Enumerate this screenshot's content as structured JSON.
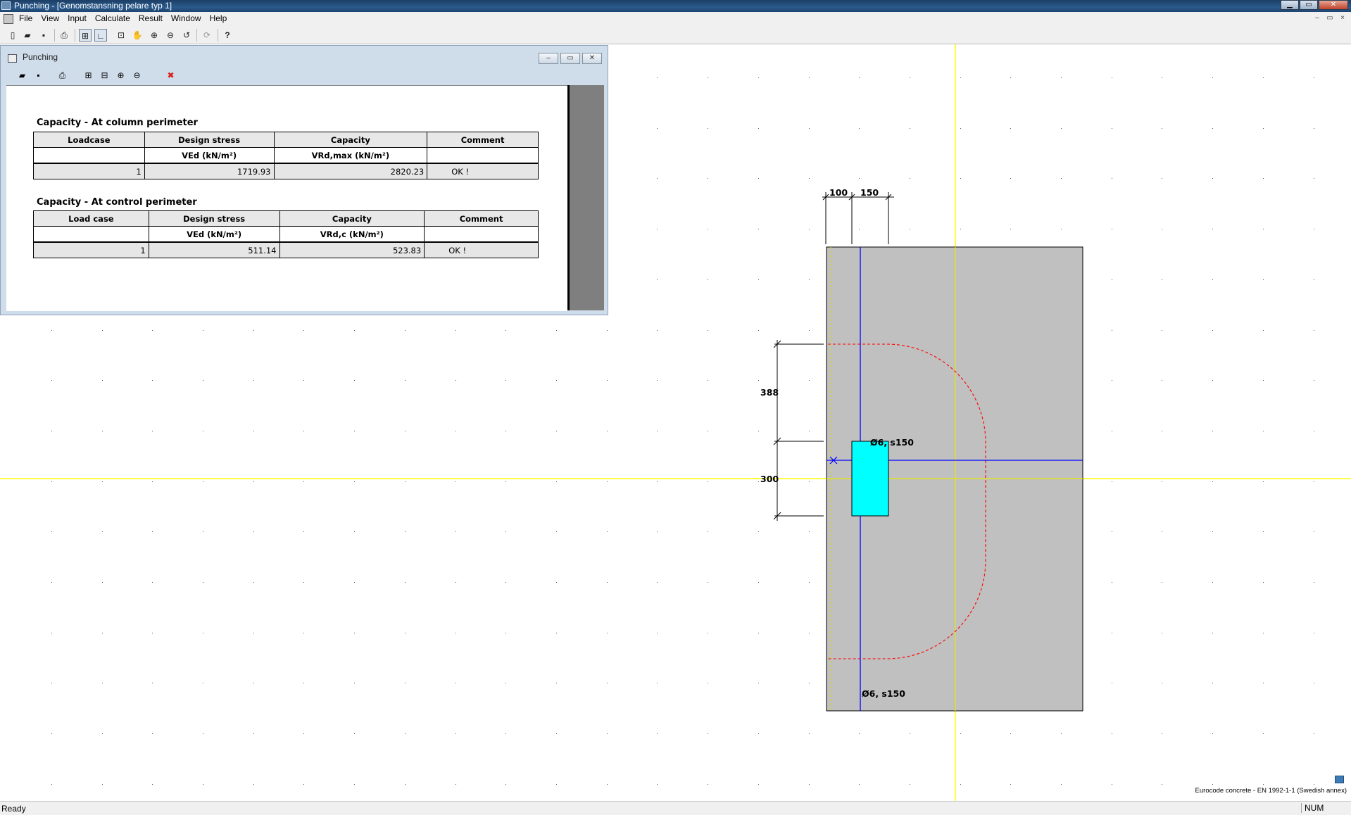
{
  "app": {
    "title": "Punching - [Genomstansning pelare typ 1]"
  },
  "window_buttons": {
    "minimize": "▁",
    "maximize": "▭",
    "close": "✕"
  },
  "menu": [
    "File",
    "View",
    "Input",
    "Calculate",
    "Result",
    "Window",
    "Help"
  ],
  "mdi_buttons": [
    "–",
    "▭",
    "×"
  ],
  "toolbar_icons": [
    {
      "name": "new-icon",
      "glyph": "▯"
    },
    {
      "name": "open-icon",
      "glyph": "▰"
    },
    {
      "name": "save-icon",
      "glyph": "▪"
    },
    {
      "name": "print-icon",
      "glyph": "⎙"
    },
    {
      "name": "grid-icon",
      "glyph": "⊞"
    },
    {
      "name": "ortho-icon",
      "glyph": "∟"
    },
    {
      "name": "zoom-extents-icon",
      "glyph": "⊡"
    },
    {
      "name": "pan-icon",
      "glyph": "✋"
    },
    {
      "name": "zoom-in-icon",
      "glyph": "⊕"
    },
    {
      "name": "zoom-out-icon",
      "glyph": "⊖"
    },
    {
      "name": "undo-zoom-icon",
      "glyph": "↺"
    },
    {
      "name": "redraw-icon",
      "glyph": "⟳"
    },
    {
      "name": "help-icon",
      "glyph": "?"
    }
  ],
  "child_window": {
    "title": "Punching",
    "buttons": [
      "–",
      "▭",
      "✕"
    ],
    "toolbar_icons": [
      {
        "name": "open-icon",
        "glyph": "▰"
      },
      {
        "name": "save-icon",
        "glyph": "▪"
      },
      {
        "name": "print-icon",
        "glyph": "⎙"
      },
      {
        "name": "fit-page-icon",
        "glyph": "⊞"
      },
      {
        "name": "fit-width-icon",
        "glyph": "⊟"
      },
      {
        "name": "zoom-in-icon",
        "glyph": "⊕"
      },
      {
        "name": "zoom-out-icon",
        "glyph": "⊖"
      },
      {
        "name": "close-report-icon",
        "glyph": "✖"
      }
    ]
  },
  "report": {
    "column": {
      "title": "Capacity  -  At  column  perimeter",
      "headers": [
        "Loadcase",
        "Design stress",
        "Capacity",
        "Comment"
      ],
      "units": [
        "",
        "VEd  (kN/m²)",
        "VRd,max  (kN/m²)",
        ""
      ],
      "row": {
        "loadcase": "1",
        "design_stress": "1719.93",
        "capacity": "2820.23",
        "comment": "OK !"
      }
    },
    "control": {
      "title": "Capacity  -  At  control  perimeter",
      "headers": [
        "Load case",
        "Design stress",
        "Capacity",
        "Comment"
      ],
      "units": [
        "",
        "VEd  (kN/m²)",
        "VRd,c   (kN/m²)",
        ""
      ],
      "row": {
        "loadcase": "1",
        "design_stress": "511.14",
        "capacity": "523.83",
        "comment": "OK !"
      }
    }
  },
  "drawing": {
    "colors": {
      "slab": "#c0c0c0",
      "column": "#00ffff",
      "axis": "#ffff00",
      "reinforcement": "#0000ff",
      "control_perimeter": "#ff0000"
    },
    "dim_top_1": "100",
    "dim_top_2": "150",
    "dim_left_1": "388",
    "dim_left_2": "300",
    "rebar_label_x": "Ø6, s150",
    "rebar_label_y": "Ø6, s150"
  },
  "code_standard": "Eurocode concrete  -  EN 1992-1-1 (Swedish annex)",
  "status": {
    "left": "Ready",
    "num": "NUM"
  }
}
